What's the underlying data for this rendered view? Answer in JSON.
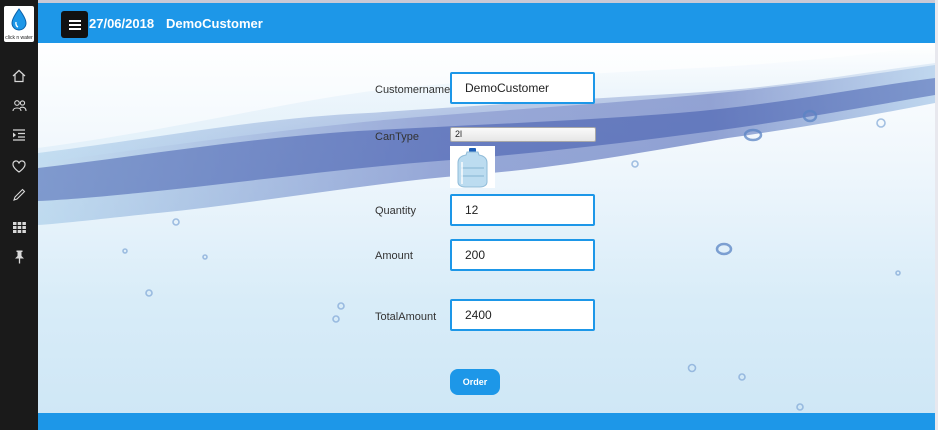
{
  "logo": {
    "text": "click n water"
  },
  "topbar": {
    "date": "27/06/2018",
    "customer": "DemoCustomer"
  },
  "sidebar": {
    "items": [
      {
        "icon": "home-icon"
      },
      {
        "icon": "users-icon"
      },
      {
        "icon": "indent-list-icon"
      },
      {
        "icon": "heart-icon"
      },
      {
        "icon": "pencil-icon"
      },
      {
        "icon": "grid-icon"
      },
      {
        "icon": "pin-icon"
      }
    ]
  },
  "form": {
    "customername_label": "Customername",
    "customername_value": "DemoCustomer",
    "cantype_label": "CanType",
    "cantype_value": "2l",
    "quantity_label": "Quantity",
    "quantity_value": "12",
    "amount_label": "Amount",
    "amount_value": "200",
    "totalamount_label": "TotalAmount",
    "totalamount_value": "2400",
    "order_label": "Order"
  },
  "colors": {
    "accent": "#1d97e8",
    "sidebar": "#1a1a1a"
  }
}
